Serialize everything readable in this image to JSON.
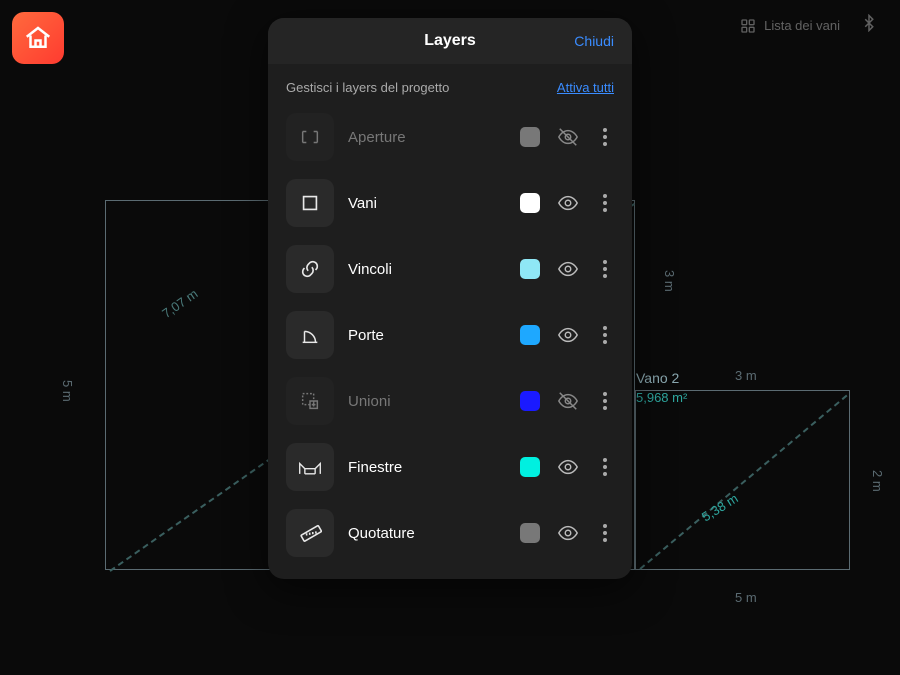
{
  "topbar": {
    "room_list_label": "Lista dei vani"
  },
  "panel": {
    "title": "Layers",
    "close_label": "Chiudi",
    "subtitle": "Gestisci i layers del progetto",
    "activate_all_label": "Attiva tutti"
  },
  "layers": [
    {
      "name": "Aperture",
      "icon": "aperture",
      "color": "#787878",
      "visible": false,
      "dimmed": true
    },
    {
      "name": "Vani",
      "icon": "square",
      "color": "#ffffff",
      "visible": true,
      "dimmed": false
    },
    {
      "name": "Vincoli",
      "icon": "link",
      "color": "#8fe7f5",
      "visible": true,
      "dimmed": false
    },
    {
      "name": "Porte",
      "icon": "door",
      "color": "#1ea8ff",
      "visible": true,
      "dimmed": false
    },
    {
      "name": "Unioni",
      "icon": "union",
      "color": "#1a1aff",
      "visible": false,
      "dimmed": true
    },
    {
      "name": "Finestre",
      "icon": "window",
      "color": "#00f0e0",
      "visible": true,
      "dimmed": false
    },
    {
      "name": "Quotature",
      "icon": "ruler",
      "color": "#787878",
      "visible": true,
      "dimmed": false
    }
  ],
  "canvas": {
    "room2_label": "Vano 2",
    "room2_area": "5,968 m²",
    "dims": {
      "diag1": "7,07 m",
      "diag2": "5,38 m",
      "top_right": "3 m",
      "right_room2": "2 m",
      "bottom_right": "5 m",
      "left": "5 m",
      "mid_right_v": "3 m"
    }
  }
}
